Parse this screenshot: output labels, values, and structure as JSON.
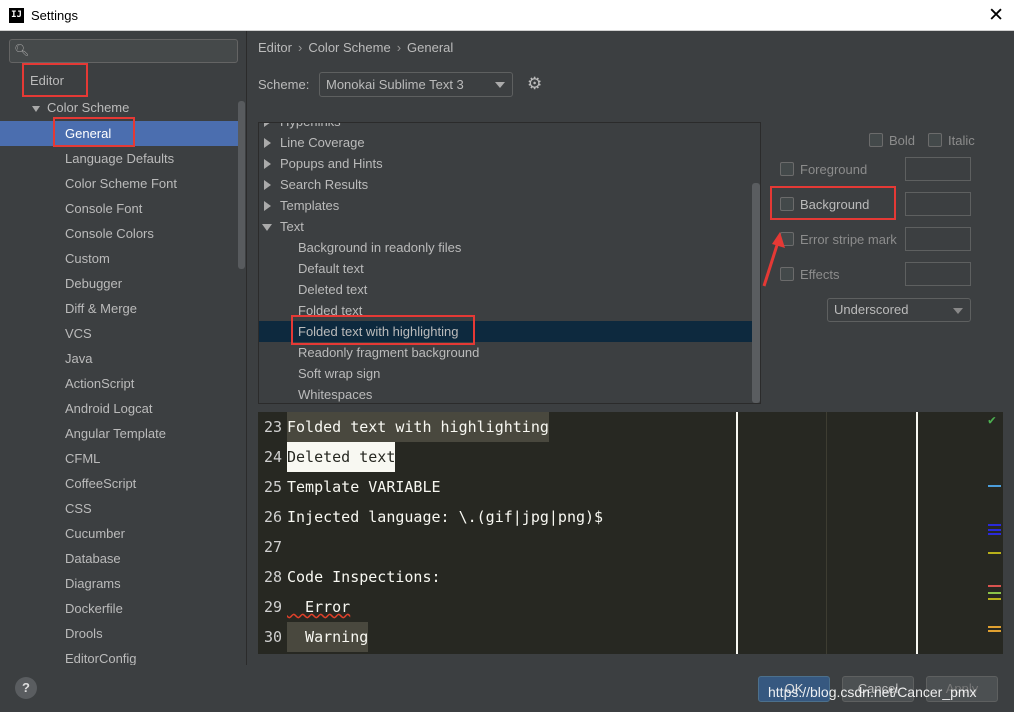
{
  "window": {
    "title": "Settings",
    "icon_text": "IJ",
    "close_icon": "close-icon"
  },
  "sidebar": {
    "search_placeholder": "",
    "root": "Editor",
    "group": "Color Scheme",
    "items": [
      "General",
      "Language Defaults",
      "Color Scheme Font",
      "Console Font",
      "Console Colors",
      "Custom",
      "Debugger",
      "Diff & Merge",
      "VCS",
      "Java",
      "ActionScript",
      "Android Logcat",
      "Angular Template",
      "CFML",
      "CoffeeScript",
      "CSS",
      "Cucumber",
      "Database",
      "Diagrams",
      "Dockerfile",
      "Drools",
      "EditorConfig"
    ],
    "selected": "General"
  },
  "breadcrumb": [
    "Editor",
    "Color Scheme",
    "General"
  ],
  "scheme": {
    "label": "Scheme:",
    "value": "Monokai Sublime Text 3"
  },
  "element_list": {
    "partial_top": "Hyperlinks",
    "collapsed": [
      "Line Coverage",
      "Popups and Hints",
      "Search Results",
      "Templates"
    ],
    "expanded": "Text",
    "children": [
      "Background in readonly files",
      "Default text",
      "Deleted text",
      "Folded text",
      "Folded text with highlighting",
      "Readonly fragment background",
      "Soft wrap sign",
      "Whitespaces"
    ],
    "selected": "Folded text with highlighting"
  },
  "options": {
    "bold": "Bold",
    "italic": "Italic",
    "foreground": "Foreground",
    "background": "Background",
    "error_stripe": "Error stripe mark",
    "effects": "Effects",
    "effects_type": "Underscored"
  },
  "preview": {
    "lines": [
      {
        "num": "23",
        "text": "Folded text with highlighting"
      },
      {
        "num": "24",
        "text": "Deleted text"
      },
      {
        "num": "25",
        "text": "Template VARIABLE"
      },
      {
        "num": "26",
        "text": "Injected language: \\.(gif|jpg|png)$"
      },
      {
        "num": "27",
        "text": ""
      },
      {
        "num": "28",
        "text": "Code Inspections:"
      },
      {
        "num": "29",
        "text": "  Error"
      },
      {
        "num": "30",
        "text": "  Warning"
      }
    ],
    "marker_colors": [
      "#4c9edb",
      "#2a2ad9",
      "#2a2ad9",
      "#2a2ad9",
      "#b8b01a",
      "#d9534f",
      "#8bc34a",
      "#b8b01a",
      "#e0a030",
      "#e0a030"
    ]
  },
  "buttons": {
    "help": "?",
    "ok": "OK",
    "cancel": "Cancel",
    "apply": "Apply"
  },
  "watermark": "https://blog.csdn.net/Cancer_pmx",
  "colors": {
    "selection": "#4b6eaf",
    "list_selection": "#0d293e",
    "annotation": "#e53935",
    "editor_bg": "#272822"
  }
}
